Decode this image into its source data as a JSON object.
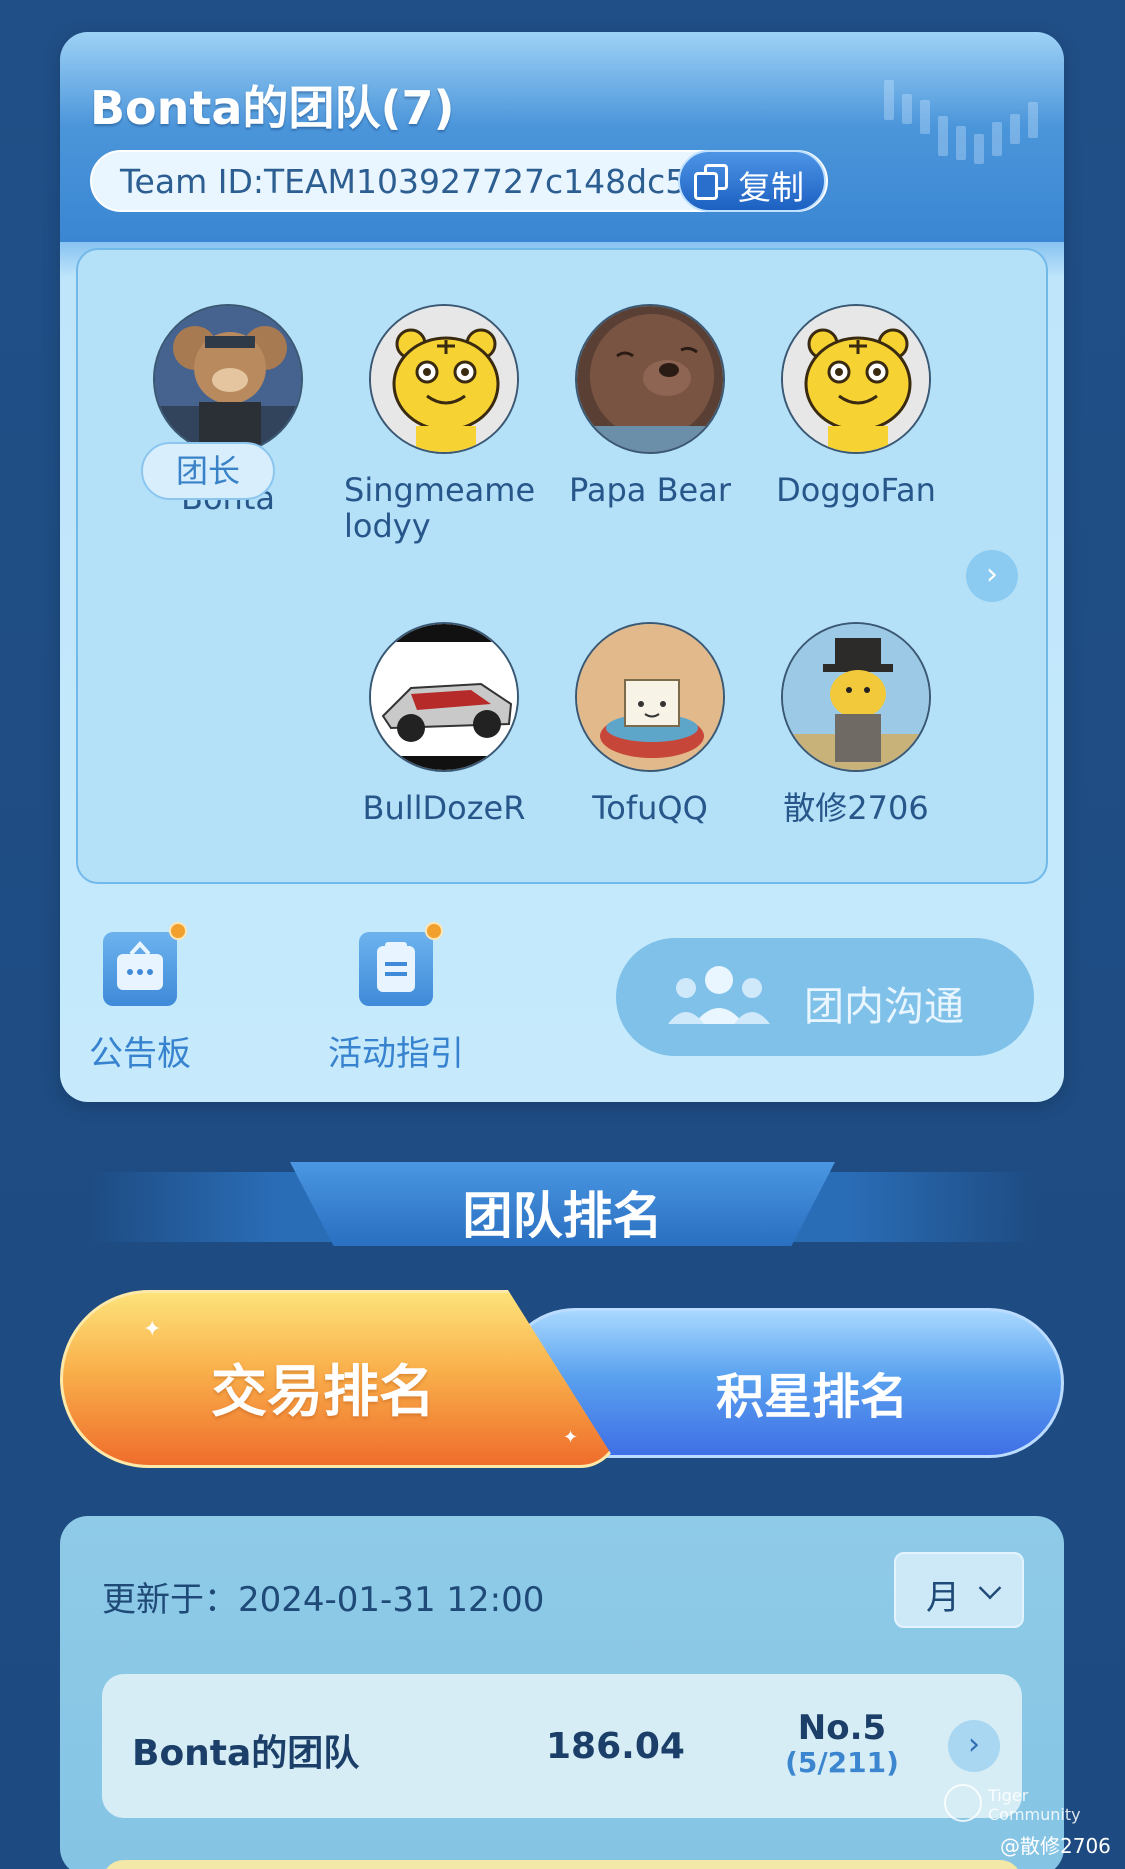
{
  "team": {
    "title": "Bonta的团队(7)",
    "team_id": "Team ID:TEAM103927727c148dc5",
    "copy_label": "复制"
  },
  "members": [
    {
      "name": "Bonta",
      "badge": "团长",
      "avatar": "bear-avatar"
    },
    {
      "name": "Singmeame lodyy",
      "avatar": "tiger-avatar"
    },
    {
      "name": "Papa Bear",
      "avatar": "teddy-bear-avatar"
    },
    {
      "name": "DoggoFan",
      "avatar": "tiger-avatar"
    },
    {
      "name": "BullDozeR",
      "avatar": "race-car-avatar"
    },
    {
      "name": "TofuQQ",
      "avatar": "tofu-avatar"
    },
    {
      "name": "散修2706",
      "avatar": "tiger-gentleman-avatar"
    }
  ],
  "tools": {
    "bulletin": "公告板",
    "guide": "活动指引",
    "chat": "团内沟通"
  },
  "ranking": {
    "title": "团队排名",
    "tabs": [
      "交易排名",
      "积星排名"
    ],
    "update_label": "更新于：2024-01-31 12:00",
    "period": "月",
    "row": {
      "name": "Bonta的团队",
      "score": "186.04",
      "rank": "No.5",
      "rank_sub": "(5/211)"
    }
  },
  "watermark": {
    "brand": "Tiger Community",
    "user": "@散修2706"
  },
  "colors": {
    "primary": "#3a86d2",
    "accent_orange": "#ef6d2c",
    "text_dark": "#1b3f68"
  }
}
